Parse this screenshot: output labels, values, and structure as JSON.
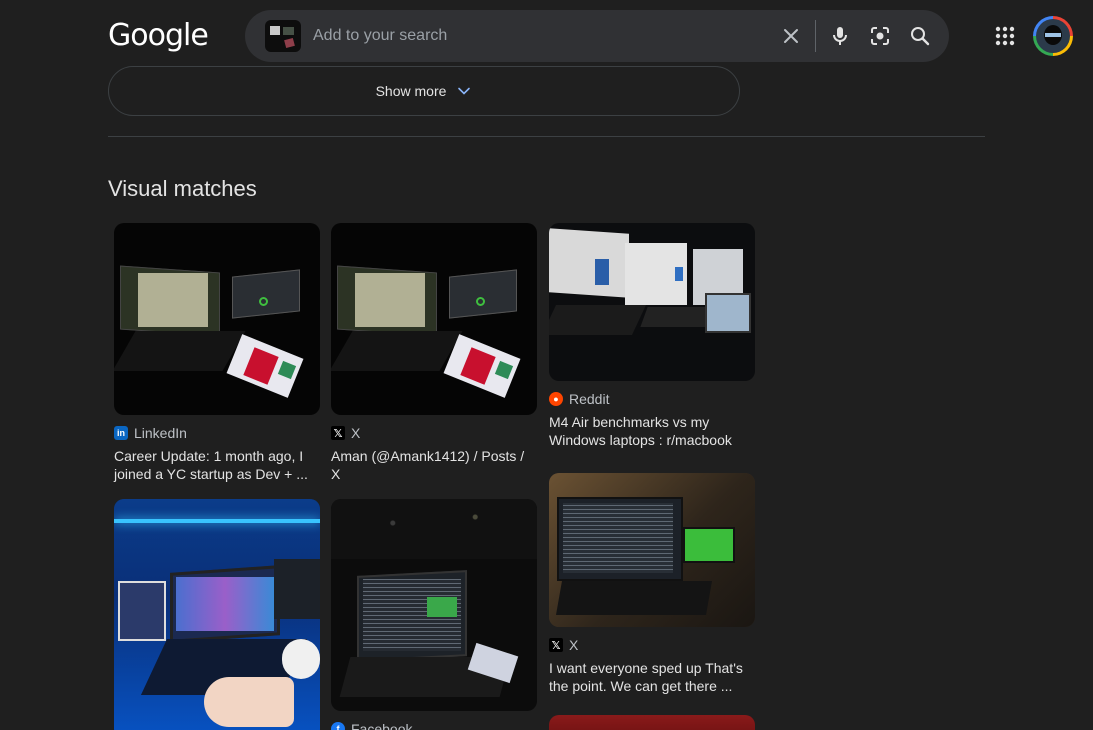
{
  "header": {
    "logo": "Google",
    "search_placeholder": "Add to your search"
  },
  "show_more": {
    "label": "Show more"
  },
  "section": {
    "title": "Visual matches"
  },
  "results": [
    {
      "source": "LinkedIn",
      "title": "Career Update: 1 month ago, I joined a YC startup as Dev + ..."
    },
    {
      "source": "X",
      "title": "Aman (@Amank1412) / Posts / X"
    },
    {
      "source": "Reddit",
      "title": "M4 Air benchmarks vs my Windows laptops : r/macbook"
    },
    {
      "source": "X",
      "title": "I want everyone sped up That's the point. We can get there ..."
    },
    {
      "source": "Facebook",
      "title": ""
    }
  ]
}
